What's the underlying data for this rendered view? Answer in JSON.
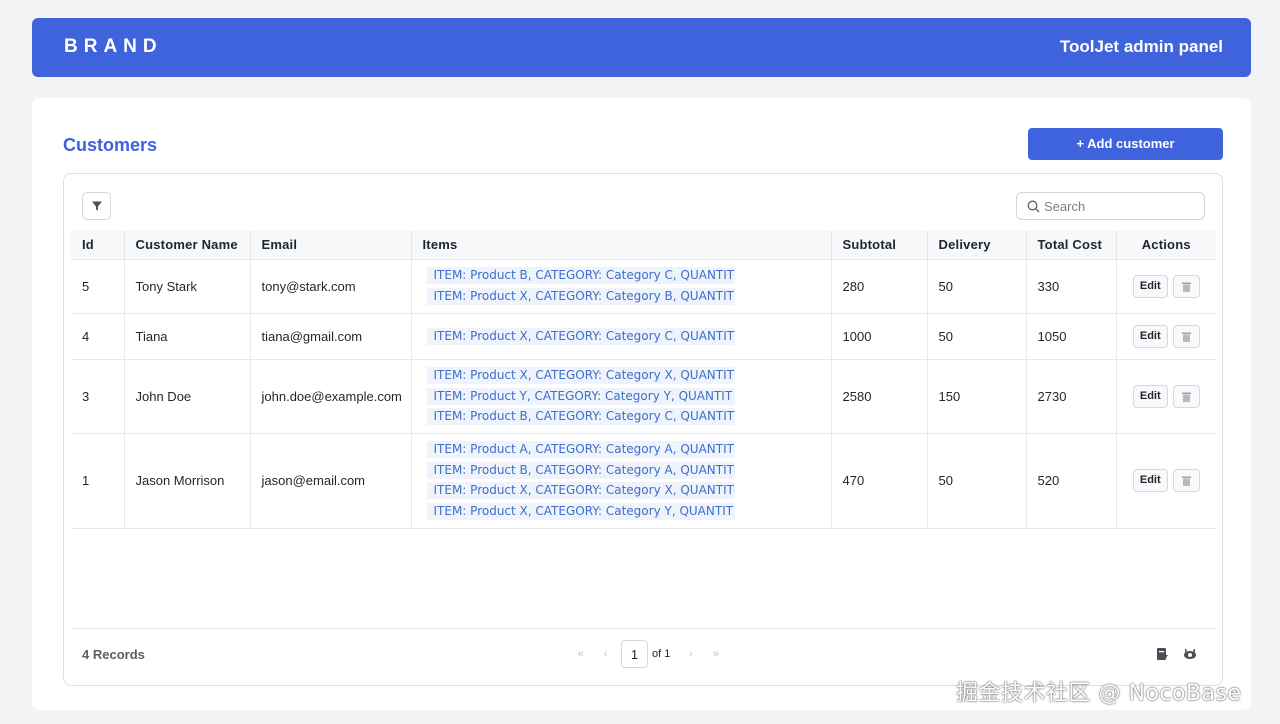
{
  "header": {
    "brand": "BRAND",
    "panel_title": "ToolJet admin panel"
  },
  "page": {
    "title": "Customers",
    "add_button": "+ Add customer"
  },
  "table": {
    "search_placeholder": "Search",
    "columns": [
      "Id",
      "Customer Name",
      "Email",
      "Items",
      "Subtotal",
      "Delivery",
      "Total Cost",
      "Actions"
    ],
    "edit_label": "Edit",
    "rows": [
      {
        "id": "5",
        "name": "Tony Stark",
        "email": "tony@stark.com",
        "items": [
          "ITEM: Product B, CATEGORY: Category C, QUANTIT",
          "ITEM: Product X, CATEGORY: Category B, QUANTIT"
        ],
        "subtotal": "280",
        "delivery": "50",
        "total": "330"
      },
      {
        "id": "4",
        "name": "Tiana",
        "email": "tiana@gmail.com",
        "items": [
          "ITEM: Product X, CATEGORY: Category C, QUANTIT"
        ],
        "subtotal": "1000",
        "delivery": "50",
        "total": "1050"
      },
      {
        "id": "3",
        "name": "John Doe",
        "email": "john.doe@example.com",
        "items": [
          "ITEM: Product X, CATEGORY: Category X, QUANTIT",
          "ITEM: Product Y, CATEGORY: Category Y, QUANTIT",
          "ITEM: Product B, CATEGORY: Category C, QUANTIT"
        ],
        "subtotal": "2580",
        "delivery": "150",
        "total": "2730"
      },
      {
        "id": "1",
        "name": "Jason Morrison",
        "email": "jason@email.com",
        "items": [
          "ITEM: Product A, CATEGORY: Category A, QUANTIT",
          "ITEM: Product B, CATEGORY: Category A, QUANTIT",
          "ITEM: Product X, CATEGORY: Category X, QUANTIT",
          "ITEM: Product X, CATEGORY: Category Y, QUANTIT"
        ],
        "subtotal": "470",
        "delivery": "50",
        "total": "520"
      }
    ]
  },
  "footer": {
    "records": "4 Records",
    "current_page": "1",
    "of_pages": "of 1",
    "pager_icons": [
      "double-left-icon",
      "left-icon",
      "right-icon",
      "double-right-icon"
    ],
    "tool_icons": [
      "download-icon",
      "column-visibility-icon"
    ]
  },
  "watermark": "掘金技术社区 @ NocoBase",
  "colors": {
    "accent": "#3e63dd",
    "tag_bg": "#eef3fc",
    "tag_text": "#3f6fc8"
  }
}
